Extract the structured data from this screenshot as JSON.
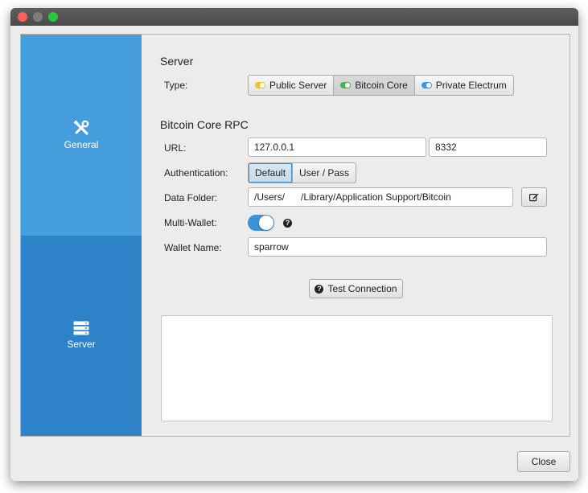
{
  "sidebar": {
    "items": [
      {
        "label": "General",
        "icon": "tools-icon"
      },
      {
        "label": "Server",
        "icon": "server-icon"
      }
    ]
  },
  "server": {
    "section_title": "Server",
    "type_label": "Type:",
    "types": [
      {
        "label": "Public Server",
        "dot_color": "#e8c629"
      },
      {
        "label": "Bitcoin Core",
        "dot_color": "#4caf50",
        "selected": true
      },
      {
        "label": "Private Electrum",
        "dot_color": "#3b9ad9"
      }
    ]
  },
  "rpc": {
    "section_title": "Bitcoin Core RPC",
    "url_label": "URL:",
    "host": "127.0.0.1",
    "port": "8332",
    "auth_label": "Authentication:",
    "auth_options": [
      "Default",
      "User / Pass"
    ],
    "auth_selected": "Default",
    "data_folder_label": "Data Folder:",
    "data_folder": "/Users/      /Library/Application Support/Bitcoin",
    "multi_wallet_label": "Multi-Wallet:",
    "multi_wallet_enabled": true,
    "help_glyph": "?",
    "wallet_name_label": "Wallet Name:",
    "wallet_name": "sparrow",
    "test_button": "Test Connection",
    "test_icon": "question-circle-icon",
    "output": ""
  },
  "footer": {
    "close_button": "Close"
  },
  "colors": {
    "accent": "#3a93d6",
    "sidebar_selected": "#459ddc",
    "sidebar_other": "#2e82c7"
  }
}
